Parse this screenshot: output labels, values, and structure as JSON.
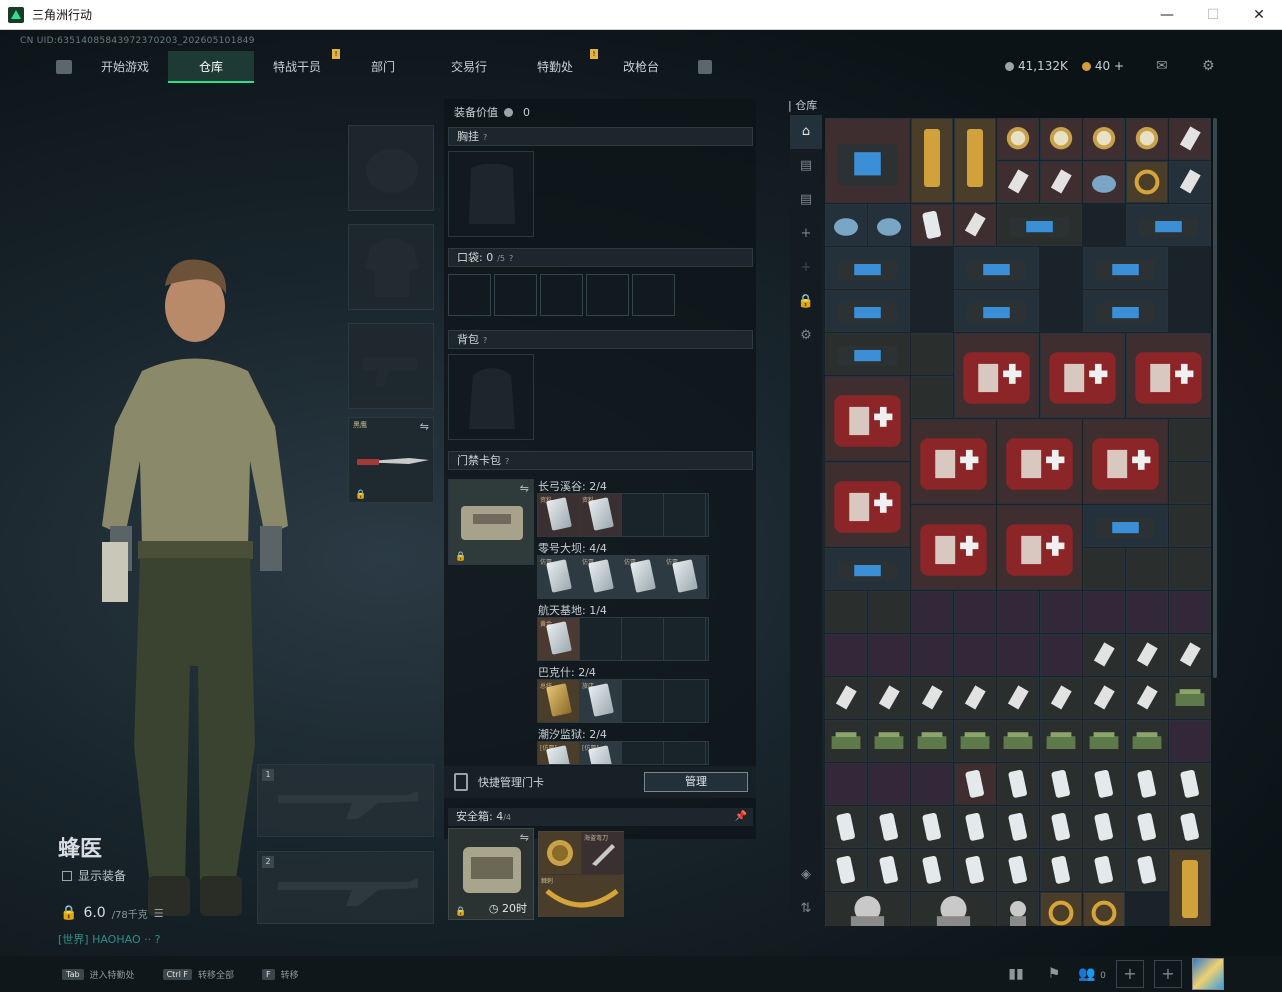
{
  "window": {
    "title": "三角洲行动",
    "minimize": "—",
    "maximize": "☐",
    "close": "✕"
  },
  "uid": "CN UID:63514085843972370203_202605101849",
  "nav": {
    "tabs": [
      "开始游戏",
      "仓库",
      "特战干员",
      "部门",
      "交易行",
      "特勤处",
      "改枪台"
    ],
    "active": "仓库"
  },
  "currency": {
    "havoc": "41,132K",
    "coin": "40",
    "plus": "+"
  },
  "character": {
    "name": "蜂医",
    "show_equip": "显示装备",
    "weight": "6.0",
    "weight_max": "/78千克",
    "world": "[世界] HAOHAO ·· ?"
  },
  "equip": {
    "value_label": "装备价值",
    "value": "0",
    "melee_label": "黑鹰"
  },
  "sections": {
    "chest": "胸挂",
    "pocket": "口袋: ",
    "pocket_count": "0",
    "pocket_max": "/5",
    "backpack": "背包",
    "keycard": "门禁卡包"
  },
  "keycard_maps": [
    {
      "label": "长弓溪谷: 2/4",
      "filled": 2,
      "items": [
        "资料",
        "资料"
      ]
    },
    {
      "label": "零号大坝: 4/4",
      "filled": 4,
      "items": [
        "仿冒",
        "仿冒",
        "仿冒",
        "仿冒"
      ]
    },
    {
      "label": "航天基地: 1/4",
      "filled": 1,
      "items": [
        "黄金"
      ]
    },
    {
      "label": "巴克什: 2/4",
      "filled": 2,
      "items": [
        "总统",
        "旅店"
      ]
    },
    {
      "label": "潮汐监狱: 2/4",
      "filled": 2,
      "items": [
        "[仿冒]",
        "[仿冒]"
      ]
    }
  ],
  "quick": {
    "label": "快捷管理门卡",
    "button": "管理"
  },
  "safe": {
    "label": "安全箱: ",
    "count": "4",
    "max": "/4",
    "time": "20时",
    "items": [
      "海盗弯刀",
      "棘刺"
    ]
  },
  "warehouse": {
    "title": "仓库"
  },
  "bottom": [
    {
      "key": "Tab",
      "text": "进入特勤处"
    },
    {
      "key": "Ctrl F",
      "text": "转移全部"
    },
    {
      "key": "F",
      "text": "转移"
    }
  ],
  "social_count": "0"
}
